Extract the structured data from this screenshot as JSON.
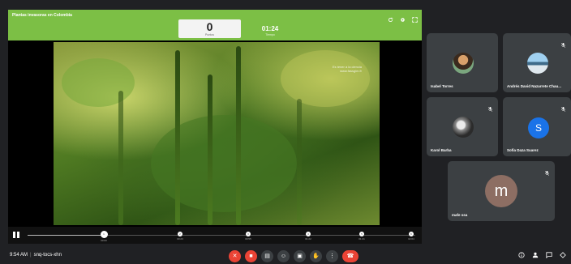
{
  "presentation": {
    "title": "Plantas invasoras en Colombia",
    "score": "0",
    "score_label": "Puntos",
    "timer": "01:24",
    "timer_label": "Tiempo",
    "watermark_line1": "Es tener a la ciencia",
    "watermark_line2": "www.fassgim.fr",
    "progress_percent": 20,
    "markers": [
      {
        "label": "1",
        "time": "00:00"
      },
      {
        "label": "2",
        "time": "00:23"
      },
      {
        "label": "3",
        "time": "00:55"
      },
      {
        "label": "4",
        "time": "01:22"
      },
      {
        "label": "5",
        "time": "01:41"
      },
      {
        "label": "6",
        "time": "02:04"
      }
    ]
  },
  "participants": [
    {
      "name": "Isabel Torres",
      "avatar": "photo",
      "muted": false
    },
    {
      "name": "Andrés David Nazarrete Chau...",
      "avatar": "photo",
      "muted": true
    },
    {
      "name": "Karol Barba",
      "avatar": "photo",
      "muted": true
    },
    {
      "name": "Sofía Daza Suarez",
      "avatar": "S",
      "avatar_color": "#1a73e8",
      "muted": true
    },
    {
      "name": "mafe ssa",
      "avatar": "m",
      "avatar_color": "#8d6e63",
      "muted": true
    }
  ],
  "bottombar": {
    "time": "9:54 AM",
    "meeting_code": "snq-tocs-xhn",
    "controls": [
      {
        "icon": "mic-off-icon",
        "glyph": "✕"
      },
      {
        "icon": "camera-off-icon",
        "glyph": "■"
      },
      {
        "icon": "captions-icon",
        "glyph": "▤"
      },
      {
        "icon": "emoji-icon",
        "glyph": "☺"
      },
      {
        "icon": "present-icon",
        "glyph": "▣"
      },
      {
        "icon": "raise-hand-icon",
        "glyph": "✋"
      },
      {
        "icon": "more-options-icon",
        "glyph": "⋮"
      },
      {
        "icon": "hangup-icon",
        "glyph": "☎"
      }
    ],
    "participant_count": "5"
  },
  "colors": {
    "presentation_bar": "#7cbf45",
    "danger": "#ea4335",
    "tile": "#3c4043",
    "background": "#202124"
  }
}
